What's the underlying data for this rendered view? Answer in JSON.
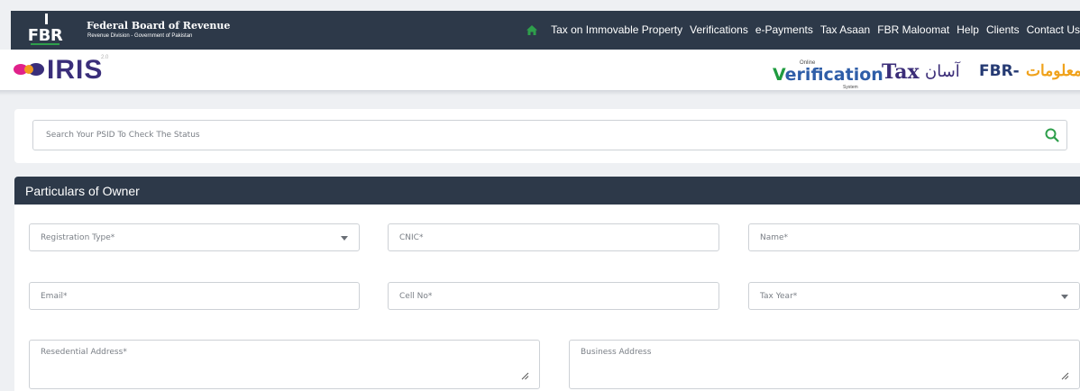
{
  "topbar": {
    "logo_text": "FBR",
    "title": "Federal Board of Revenue",
    "subtitle": "Revenue Division - Government of Pakistan",
    "nav": [
      {
        "label": "Tax on Immovable Property"
      },
      {
        "label": "Verifications"
      },
      {
        "label": "e-Payments"
      },
      {
        "label": "Tax Asaan"
      },
      {
        "label": "FBR Maloomat"
      },
      {
        "label": "Help"
      },
      {
        "label": "Clients"
      },
      {
        "label": "Contact Us"
      }
    ]
  },
  "header": {
    "iris_text": "IRIS",
    "iris_version": "2.0",
    "verification": {
      "small_top": "Online",
      "v": "V",
      "rest": "erification",
      "small_bottom": "System"
    },
    "tax_asaan": {
      "en": "Tax",
      "ur": "آسان"
    },
    "fbr_maloomat": {
      "en": "FBR-",
      "ur": "معلومات"
    }
  },
  "search": {
    "placeholder": "Search Your PSID To Check The Status",
    "value": ""
  },
  "section": {
    "title": "Particulars of Owner"
  },
  "form": {
    "registration_type": {
      "placeholder": "Registration Type*"
    },
    "cnic": {
      "placeholder": "CNIC*"
    },
    "name": {
      "placeholder": "Name*"
    },
    "email": {
      "placeholder": "Email*"
    },
    "cell_no": {
      "placeholder": "Cell No*"
    },
    "tax_year": {
      "placeholder": "Tax Year*"
    },
    "residential_address": {
      "placeholder": "Resedential Address*"
    },
    "business_address": {
      "placeholder": "Business Address"
    }
  },
  "colors": {
    "navy": "#2d3949",
    "accent_green": "#2e9f4b",
    "iris_purple": "#3a2e7a"
  },
  "icons": {
    "home": "home-icon",
    "search": "search-icon",
    "caret": "chevron-down-icon",
    "resize": "resize-handle-icon"
  }
}
